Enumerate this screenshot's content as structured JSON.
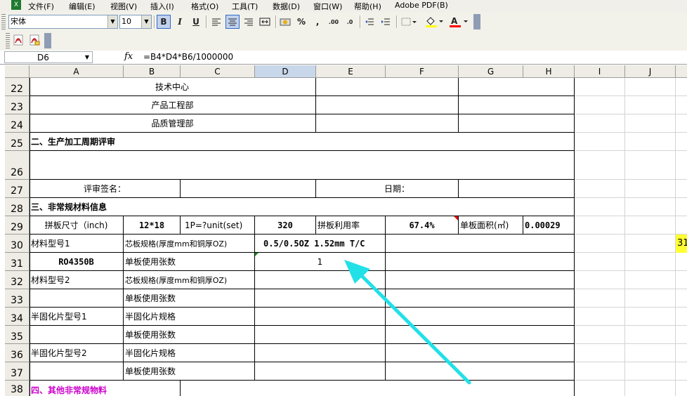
{
  "menu": [
    "文件(F)",
    "编辑(E)",
    "视图(V)",
    "插入(I)",
    "格式(O)",
    "工具(T)",
    "数据(D)",
    "窗口(W)",
    "帮助(H)",
    "Adobe PDF(B)"
  ],
  "toolbar": {
    "font": "宋体",
    "size": "10",
    "bold": "B",
    "italic": "I",
    "underline": "U",
    "percent": "%",
    "comma": ","
  },
  "formula_bar": {
    "cell_ref": "D6",
    "fx": "fx",
    "formula": "=B4*D4*B6/1000000"
  },
  "columns": [
    "A",
    "B",
    "C",
    "D",
    "E",
    "F",
    "G",
    "H",
    "I",
    "J"
  ],
  "rows": [
    "22",
    "23",
    "24",
    "25",
    "26",
    "27",
    "28",
    "29",
    "30",
    "31",
    "32",
    "33",
    "34",
    "35",
    "36",
    "37",
    "38"
  ],
  "cells": {
    "r22": "技术中心",
    "r23": "产品工程部",
    "r24": "品质管理部",
    "r25": "二、生产加工周期评审",
    "r27a": "评审签名：",
    "r27e": "日期：",
    "r28": "三、非常规材料信息",
    "r29a": "拼板尺寸（inch)",
    "r29b": "12*18",
    "r29c": "1P=?unit(set)",
    "r29d": "320",
    "r29e": "拼板利用率",
    "r29f": "67.4%",
    "r29g": "单板面积(㎡)",
    "r29h": "0.00029",
    "r30a": "材料型号1",
    "r30b": "芯板规格(厚度mm和铜厚OZ)",
    "r30d": "0.5/0.5OZ 1.52mm T/C",
    "r31a": "RO4350B",
    "r31b": "单板使用张数",
    "r31d": "1",
    "r32a": "材料型号2",
    "r32b": "芯板规格(厚度mm和铜厚OZ)",
    "r33b": "单板使用张数",
    "r34a": "半固化片型号1",
    "r34b": "半固化片规格",
    "r35b": "单板使用张数",
    "r36a": "半固化片型号2",
    "r36b": "半固化片规格",
    "r37b": "单板使用张数",
    "r38": "四、其他非常规物料",
    "side_marker": "31"
  },
  "colors": {
    "annotation_arrow": "#22e0e8",
    "accent_text": "#cc00cc",
    "selected_header": "#c9d7ea"
  }
}
